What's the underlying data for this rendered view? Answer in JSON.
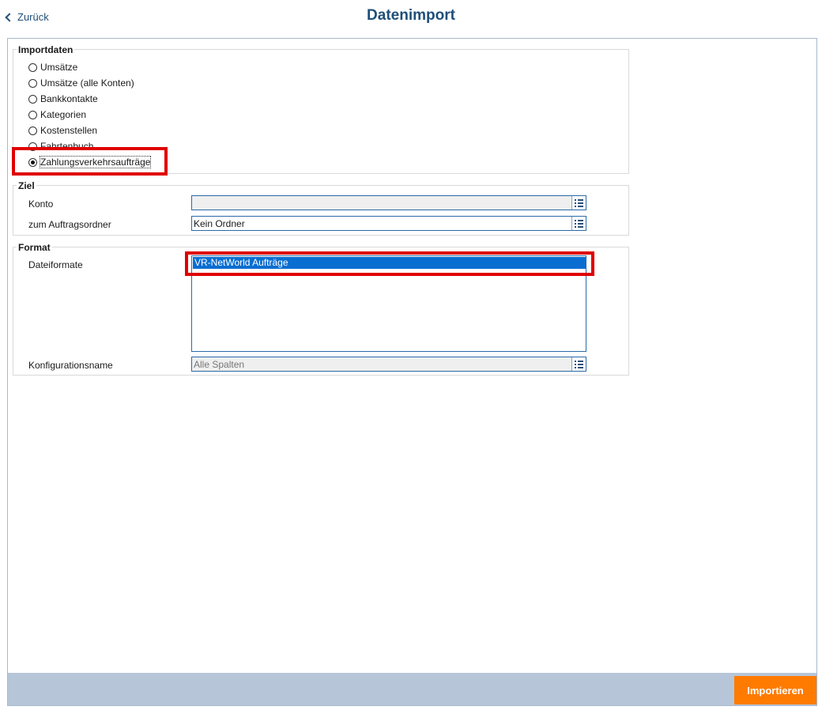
{
  "header": {
    "back_label": "Zurück",
    "title": "Datenimport"
  },
  "importdaten": {
    "legend": "Importdaten",
    "options": [
      {
        "label": "Umsätze",
        "checked": false
      },
      {
        "label": "Umsätze (alle Konten)",
        "checked": false
      },
      {
        "label": "Bankkontakte",
        "checked": false
      },
      {
        "label": "Kategorien",
        "checked": false
      },
      {
        "label": "Kostenstellen",
        "checked": false
      },
      {
        "label": "Fahrtenbuch",
        "checked": false
      },
      {
        "label": "Zahlungsverkehrsaufträge",
        "checked": true
      }
    ]
  },
  "ziel": {
    "legend": "Ziel",
    "konto_label": "Konto",
    "konto_value": "",
    "ordner_label": "zum Auftragsordner",
    "ordner_value": "Kein Ordner"
  },
  "format": {
    "legend": "Format",
    "dateiformate_label": "Dateiformate",
    "dateiformate_options": [
      "VR-NetWorld Aufträge"
    ],
    "konfig_label": "Konfigurationsname",
    "konfig_value": "Alle Spalten"
  },
  "footer": {
    "import_label": "Importieren"
  },
  "colors": {
    "accent": "#1f4e79",
    "button": "#ff7b00",
    "footer": "#b6c6d8",
    "highlight": "#e00000",
    "selection": "#0a6ed1"
  }
}
